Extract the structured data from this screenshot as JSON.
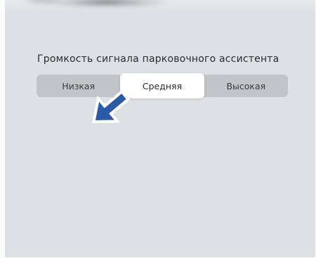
{
  "parking_assist": {
    "title": "Громкость сигнала парковочного ассистента",
    "options": [
      {
        "label": "Низкая",
        "selected": false
      },
      {
        "label": "Средняя",
        "selected": true
      },
      {
        "label": "Высокая",
        "selected": false
      }
    ]
  },
  "pointer": {
    "icon": "arrow-pointer-icon",
    "fill_color": "#2a5aa9",
    "outline_color": "#ffffff"
  },
  "colors": {
    "screen_background": "#dee1e4",
    "segment_track": "#c2c5c8",
    "segment_selected": "#ffffff"
  }
}
